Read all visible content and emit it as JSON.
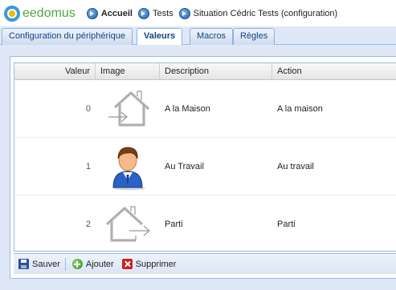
{
  "app": {
    "logo_text": "eedomus"
  },
  "breadcrumb": [
    {
      "label": "Accueil",
      "icon": "arrow-circle-icon",
      "bold": true
    },
    {
      "label": "Tests",
      "icon": "arrow-circle-icon",
      "bold": false
    },
    {
      "label": "Situation Cédric Tests (configuration)",
      "icon": "arrow-circle-icon",
      "bold": false
    }
  ],
  "tabs": [
    {
      "label": "Configuration du périphérique",
      "active": false
    },
    {
      "label": "Valeurs",
      "active": true
    },
    {
      "label": "Macros",
      "active": false
    },
    {
      "label": "Règles",
      "active": false
    }
  ],
  "grid": {
    "columns": [
      "Valeur",
      "Image",
      "Description",
      "Action"
    ],
    "rows": [
      {
        "valeur": "0",
        "image": "house-arrow-in-icon",
        "description": "A la Maison",
        "action": "A la maison"
      },
      {
        "valeur": "1",
        "image": "person-avatar-icon",
        "description": "Au Travail",
        "action": "Au travail"
      },
      {
        "valeur": "2",
        "image": "house-arrow-out-icon",
        "description": "Parti",
        "action": "Parti"
      }
    ]
  },
  "toolbar": {
    "save_label": "Sauver",
    "add_label": "Ajouter",
    "delete_label": "Supprimer"
  },
  "colors": {
    "brand_green": "#49a942",
    "brand_blue": "#3a9ad9",
    "tab_text": "#15428b",
    "panel_bg": "#dfe8f6"
  }
}
